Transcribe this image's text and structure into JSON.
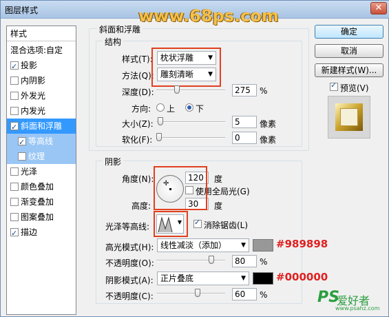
{
  "window": {
    "title": "图层样式",
    "watermark": "www.68ps.com",
    "close": "✕"
  },
  "sidebar": {
    "header": "样式",
    "blend": "混合选项:自定",
    "items": [
      {
        "label": "投影",
        "checked": true
      },
      {
        "label": "内阴影",
        "checked": false
      },
      {
        "label": "外发光",
        "checked": false
      },
      {
        "label": "内发光",
        "checked": false
      },
      {
        "label": "斜面和浮雕",
        "checked": true
      },
      {
        "label": "等高线",
        "checked": true
      },
      {
        "label": "纹理",
        "checked": false
      },
      {
        "label": "光泽",
        "checked": false
      },
      {
        "label": "颜色叠加",
        "checked": false
      },
      {
        "label": "渐变叠加",
        "checked": false
      },
      {
        "label": "图案叠加",
        "checked": false
      },
      {
        "label": "描边",
        "checked": true
      }
    ]
  },
  "bevel": {
    "group": "斜面和浮雕",
    "structure": "结构",
    "style_label": "样式(T):",
    "style_value": "枕状浮雕",
    "method_label": "方法(Q):",
    "method_value": "雕刻清晰",
    "depth_label": "深度(D):",
    "depth_value": "275",
    "depth_unit": "%",
    "direction_label": "方向:",
    "dir_up": "上",
    "dir_down": "下",
    "size_label": "大小(Z):",
    "size_value": "5",
    "size_unit": "像素",
    "soften_label": "软化(F):",
    "soften_value": "0",
    "soften_unit": "像素"
  },
  "shading": {
    "group": "阴影",
    "angle_label": "角度(N):",
    "angle_value": "120",
    "angle_unit": "度",
    "global_light": "使用全局光(G)",
    "altitude_label": "高度:",
    "altitude_value": "30",
    "altitude_unit": "度",
    "gloss_label": "光泽等高线:",
    "antialias": "消除锯齿(L)",
    "highlight_label": "高光模式(H):",
    "highlight_mode": "线性减淡（添加）",
    "highlight_color": "#989898",
    "highlight_annotation": "#989898",
    "opacity1_label": "不透明度(O):",
    "opacity1_value": "80",
    "opacity1_unit": "%",
    "shadow_label": "阴影模式(A):",
    "shadow_mode": "正片叠底",
    "shadow_color": "#000000",
    "shadow_annotation": "#000000",
    "opacity2_label": "不透明度(C):",
    "opacity2_value": "60",
    "opacity2_unit": "%"
  },
  "buttons": {
    "ok": "确定",
    "cancel": "取消",
    "new_style": "新建样式(W)...",
    "preview": "预览(V)"
  },
  "logo": {
    "ps": "PS",
    "text": "爱好者",
    "site": "www.psahz.com"
  }
}
